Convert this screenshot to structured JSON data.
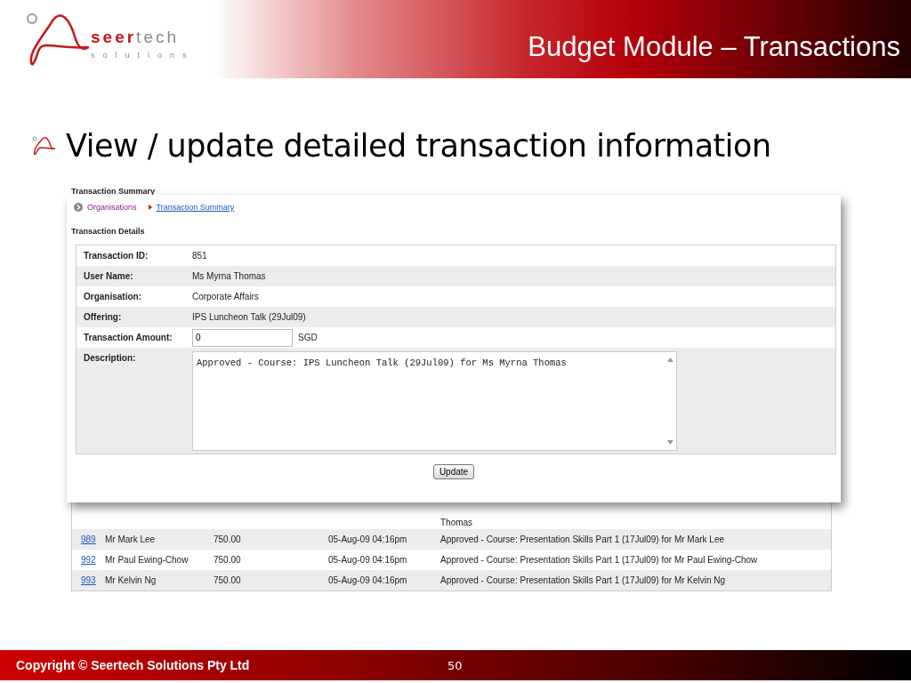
{
  "header": {
    "brand_part_1": "seer",
    "brand_part_2": "tech",
    "brand_tagline": "solutions",
    "title": "Budget Module – Transactions"
  },
  "bullet": "View / update detailed transaction information",
  "screenshot": {
    "caption": "Transaction Summary",
    "breadcrumb": [
      {
        "label": "Organisations",
        "kind": "visited"
      },
      {
        "label": "Transaction Summary",
        "kind": "link"
      }
    ],
    "section_title": "Transaction Details",
    "fields": [
      {
        "label": "Transaction ID:",
        "kind": "text",
        "value": "851"
      },
      {
        "label": "User Name:",
        "kind": "text",
        "value": "Ms Myrna Thomas"
      },
      {
        "label": "Organisation:",
        "kind": "text",
        "value": "Corporate Affairs"
      },
      {
        "label": "Offering:",
        "kind": "text",
        "value": "IPS Luncheon Talk (29Jul09)"
      },
      {
        "label": "Transaction Amount:",
        "kind": "input",
        "value": "0",
        "unit": "SGD"
      },
      {
        "label": "Description:",
        "kind": "textarea",
        "value": "Approved - Course: IPS Luncheon Talk (29Jul09) for Ms Myrna Thomas"
      }
    ],
    "button": "Update",
    "rows": [
      {
        "kind": "partial",
        "description": "Thomas"
      },
      {
        "kind": "full",
        "id": "989",
        "name": "Mr Mark Lee",
        "amount": "750.00",
        "date": "05-Aug-09 04:16pm",
        "description": "Approved - Course: Presentation Skills Part 1 (17Jul09) for Mr Mark Lee"
      },
      {
        "kind": "full",
        "id": "992",
        "name": "Mr Paul Ewing-Chow",
        "amount": "750.00",
        "date": "05-Aug-09 04:16pm",
        "description": "Approved - Course: Presentation Skills Part 1 (17Jul09) for Mr Paul Ewing-Chow"
      },
      {
        "kind": "full",
        "id": "993",
        "name": "Mr Kelvin Ng",
        "amount": "750.00",
        "date": "05-Aug-09 04:16pm",
        "description": "Approved - Course: Presentation Skills Part 1 (17Jul09) for Mr Kelvin Ng"
      }
    ]
  },
  "footer": {
    "copyright": "Copyright © Seertech Solutions Pty Ltd",
    "page_number": "50"
  }
}
